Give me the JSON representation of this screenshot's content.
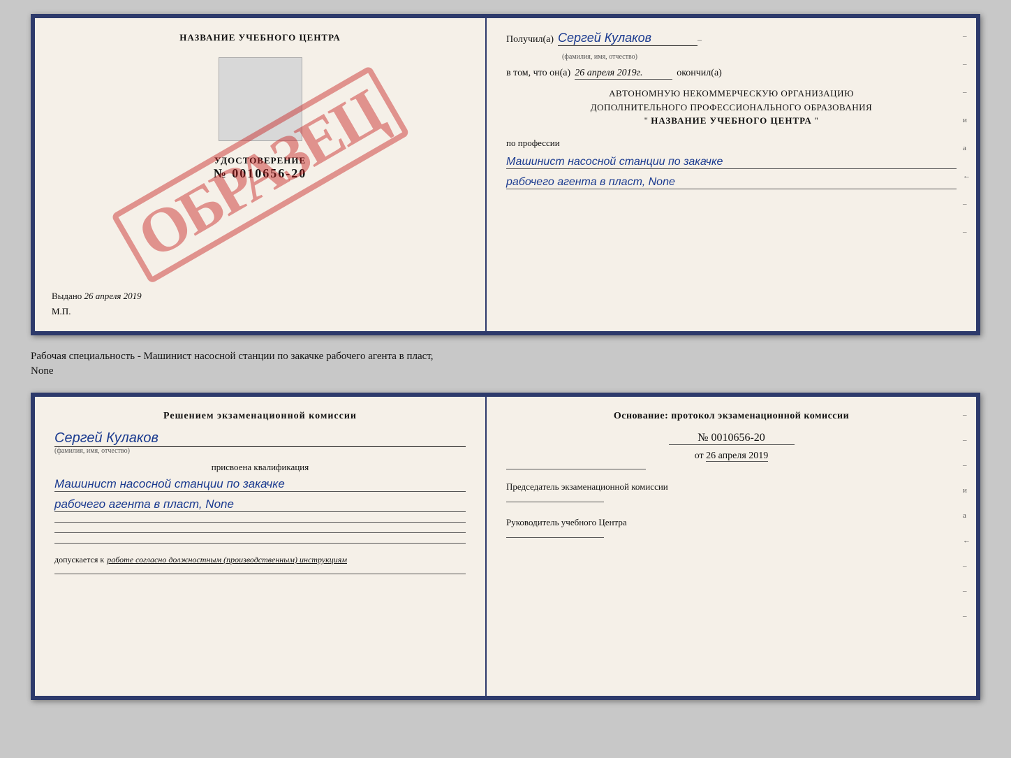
{
  "top_doc": {
    "left": {
      "title": "НАЗВАНИЕ УЧЕБНОГО ЦЕНТРА",
      "cert_label": "УДОСТОВЕРЕНИЕ",
      "cert_number": "№ 0010656-20",
      "watermark": "ОБРАЗЕЦ",
      "issued_label": "Выдано",
      "issued_date": "26 апреля 2019",
      "mp_label": "М.П."
    },
    "right": {
      "recipient_prefix": "Получил(а)",
      "recipient_name": "Сергей Кулаков",
      "recipient_sub": "(фамилия, имя, отчество)",
      "date_prefix": "в том, что он(а)",
      "date_value": "26 апреля 2019г.",
      "date_suffix": "окончил(а)",
      "org_line1": "АВТОНОМНУЮ НЕКОММЕРЧЕСКУЮ ОРГАНИЗАЦИЮ",
      "org_line2": "ДОПОЛНИТЕЛЬНОГО ПРОФЕССИОНАЛЬНОГО ОБРАЗОВАНИЯ",
      "org_quote1": "\"",
      "org_name": "НАЗВАНИЕ УЧЕБНОГО ЦЕНТРА",
      "org_quote2": "\"",
      "profession_label": "по профессии",
      "profession_line1": "Машинист насосной станции по закачке",
      "profession_line2": "рабочего агента в пласт, None",
      "side_chars": [
        "-",
        "-",
        "-",
        "и",
        "а",
        "←",
        "-",
        "-",
        "-"
      ]
    }
  },
  "description": {
    "text": "Рабочая специальность - Машинист насосной станции по закачке рабочего агента в пласт,",
    "text2": "None"
  },
  "bottom_doc": {
    "left": {
      "commission_title": "Решением экзаменационной комиссии",
      "person_name": "Сергей Кулаков",
      "name_sub": "(фамилия, имя, отчество)",
      "qualification_label": "присвоена квалификация",
      "qualification_line1": "Машинист насосной станции по закачке",
      "qualification_line2": "рабочего агента в пласт, None",
      "admission_prefix": "допускается к",
      "admission_italic": "работе согласно должностным (производственным) инструкциям"
    },
    "right": {
      "basis_title": "Основание: протокол экзаменационной комиссии",
      "protocol_number": "№ 0010656-20",
      "date_prefix": "от",
      "date_value": "26 апреля 2019",
      "chairman_label": "Председатель экзаменационной комиссии",
      "director_label": "Руководитель учебного Центра",
      "side_chars": [
        "-",
        "-",
        "-",
        "и",
        "а",
        "←",
        "-",
        "-",
        "-"
      ]
    }
  }
}
